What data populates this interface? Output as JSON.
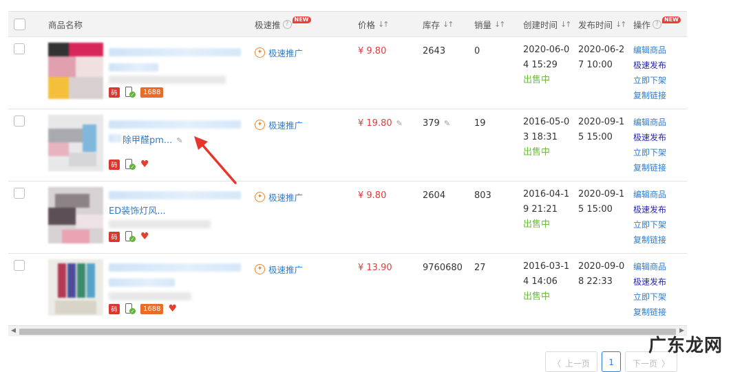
{
  "header": {
    "product_name": "商品名称",
    "quick_promo": "极速推",
    "new_badge": "NEW",
    "price": "价格",
    "stock": "库存",
    "sales": "销量",
    "created_time": "创建时间",
    "publish_time": "发布时间",
    "actions": "操作"
  },
  "rows": [
    {
      "title_line": "",
      "price": "¥ 9.80",
      "stock": "2643",
      "sales": "0",
      "created_a": "2020-06-0",
      "created_b": "4 15:29",
      "published_a": "2020-06-2",
      "published_b": "7 10:00",
      "status": "出售中",
      "promo": "极速推广",
      "has_1688": true,
      "badge_1688": "1688"
    },
    {
      "title_line": "除甲醛pm...",
      "price": "¥ 19.80",
      "stock": "379",
      "sales": "19",
      "created_a": "2016-05-0",
      "created_b": "3 18:31",
      "published_a": "2020-09-1",
      "published_b": "5 15:00",
      "status": "出售中",
      "promo": "极速推广",
      "has_1688": false
    },
    {
      "title_line": "ED装饰灯风...",
      "price": "¥ 9.80",
      "stock": "2604",
      "sales": "803",
      "created_a": "2016-04-1",
      "created_b": "9 21:21",
      "published_a": "2020-09-1",
      "published_b": "5 15:00",
      "status": "出售中",
      "promo": "极速推广",
      "has_1688": false
    },
    {
      "title_line": "",
      "price": "¥ 13.90",
      "stock": "9760680",
      "sales": "27",
      "created_a": "2016-03-1",
      "created_b": "4 14:06",
      "published_a": "2020-09-0",
      "published_b": "8 22:33",
      "status": "出售中",
      "promo": "极速推广",
      "has_1688": true,
      "badge_1688": "1688"
    }
  ],
  "actions": {
    "edit": "编辑商品",
    "quick_publish": "极速发布",
    "delist": "立即下架",
    "copy_link": "复制链接"
  },
  "badges": {
    "ma": "码"
  },
  "pagination": {
    "prev": "上一页",
    "page": "1",
    "next": "下一页"
  },
  "watermark": "广东龙网",
  "colors": {
    "link": "#2d7cd1",
    "price": "#e23c3c",
    "status": "#6cbc3a",
    "new": "#ee3b3b",
    "arrow": "#e8352b"
  }
}
